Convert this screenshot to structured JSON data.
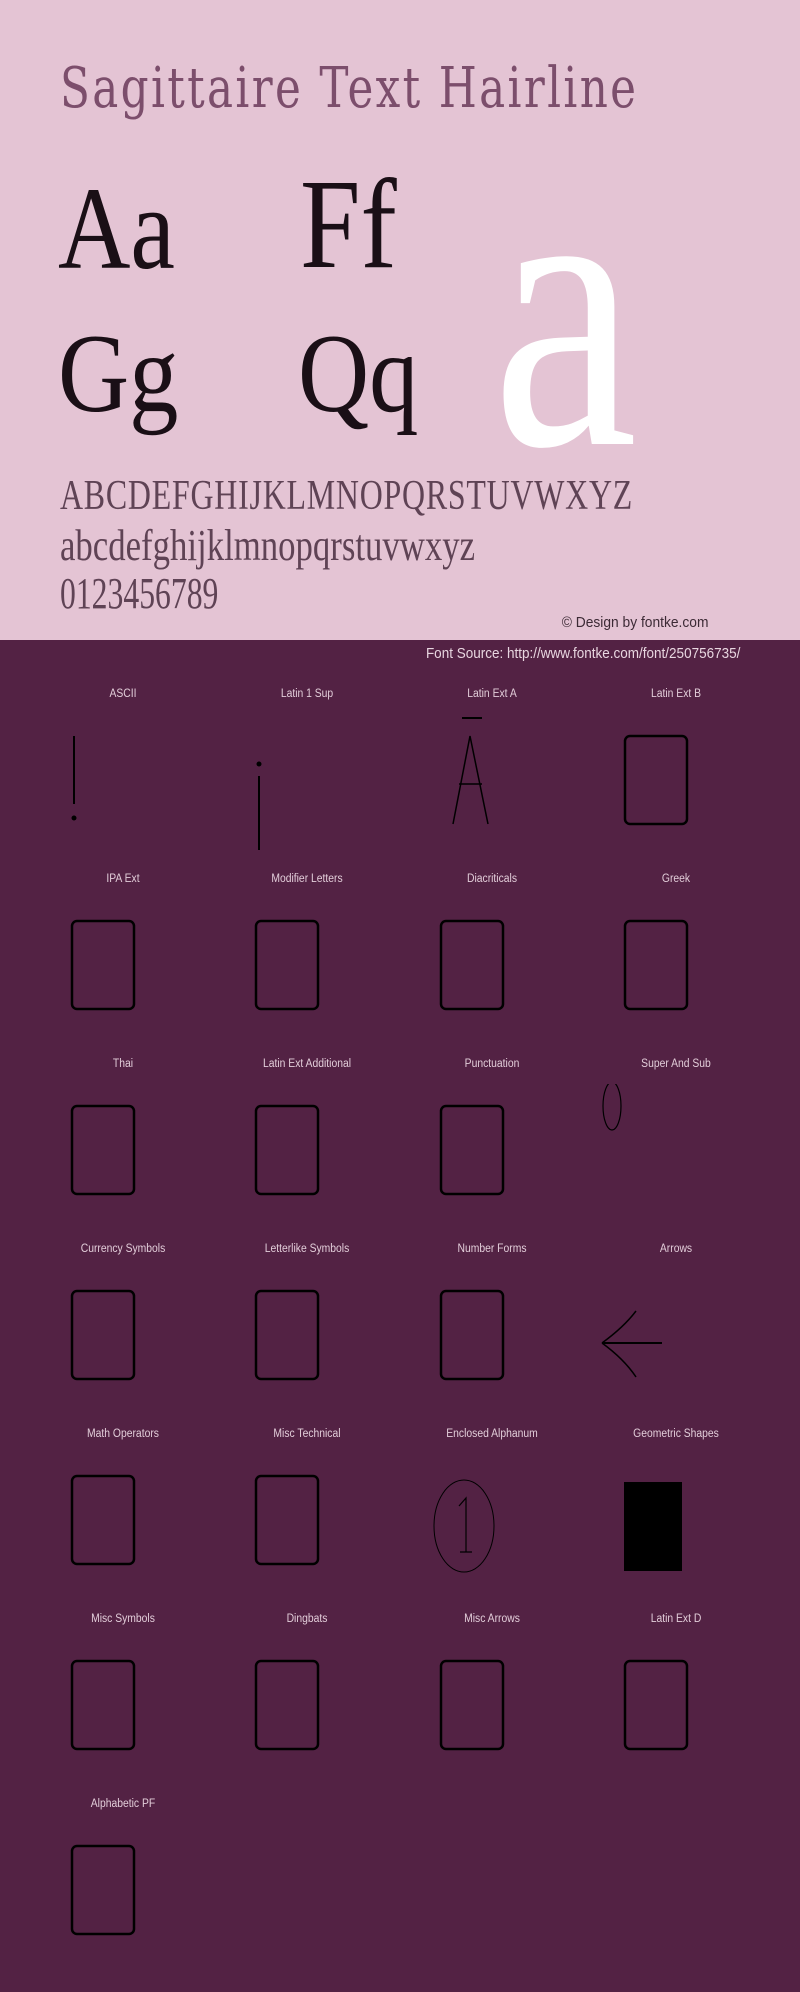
{
  "header": {
    "title": "Sagittaire Text Hairline",
    "pairs": {
      "aa": "Aa",
      "ff": "Ff",
      "gg": "Gg",
      "qq": "Qq"
    },
    "feature_glyph": "a",
    "uppercase": "ABCDEFGHIJKLMNOPQRSTUVWXYZ",
    "lowercase": "abcdefghijklmnopqrstuvwxyz",
    "digits": "0123456789",
    "credit": "© Design by fontke.com"
  },
  "source": {
    "label": "Font Source: http://www.fontke.com/font/250756735/"
  },
  "colors": {
    "hero_bg": "#e4c4d4",
    "page_bg": "#532244",
    "glyph": "#000000",
    "feature_glyph": "#ffffff"
  },
  "blocks": [
    {
      "label": "ASCII",
      "glyph": "exclamation"
    },
    {
      "label": "Latin 1 Sup",
      "glyph": "inverted-exclamation"
    },
    {
      "label": "Latin Ext A",
      "glyph": "A-macron"
    },
    {
      "label": "Latin Ext B",
      "glyph": "missing"
    },
    {
      "label": "IPA Ext",
      "glyph": "missing"
    },
    {
      "label": "Modifier Letters",
      "glyph": "missing"
    },
    {
      "label": "Diacriticals",
      "glyph": "missing"
    },
    {
      "label": "Greek",
      "glyph": "missing"
    },
    {
      "label": "Thai",
      "glyph": "missing"
    },
    {
      "label": "Latin Ext Additional",
      "glyph": "missing"
    },
    {
      "label": "Punctuation",
      "glyph": "missing"
    },
    {
      "label": "Super And Sub",
      "glyph": "superscript-zero"
    },
    {
      "label": "Currency Symbols",
      "glyph": "missing"
    },
    {
      "label": "Letterlike Symbols",
      "glyph": "missing"
    },
    {
      "label": "Number Forms",
      "glyph": "missing"
    },
    {
      "label": "Arrows",
      "glyph": "left-arrow"
    },
    {
      "label": "Math Operators",
      "glyph": "missing"
    },
    {
      "label": "Misc Technical",
      "glyph": "missing"
    },
    {
      "label": "Enclosed Alphanum",
      "glyph": "circled-one"
    },
    {
      "label": "Geometric Shapes",
      "glyph": "black-square"
    },
    {
      "label": "Misc Symbols",
      "glyph": "missing"
    },
    {
      "label": "Dingbats",
      "glyph": "missing"
    },
    {
      "label": "Misc Arrows",
      "glyph": "missing"
    },
    {
      "label": "Latin Ext D",
      "glyph": "missing"
    },
    {
      "label": "Alphabetic PF",
      "glyph": "missing"
    }
  ]
}
